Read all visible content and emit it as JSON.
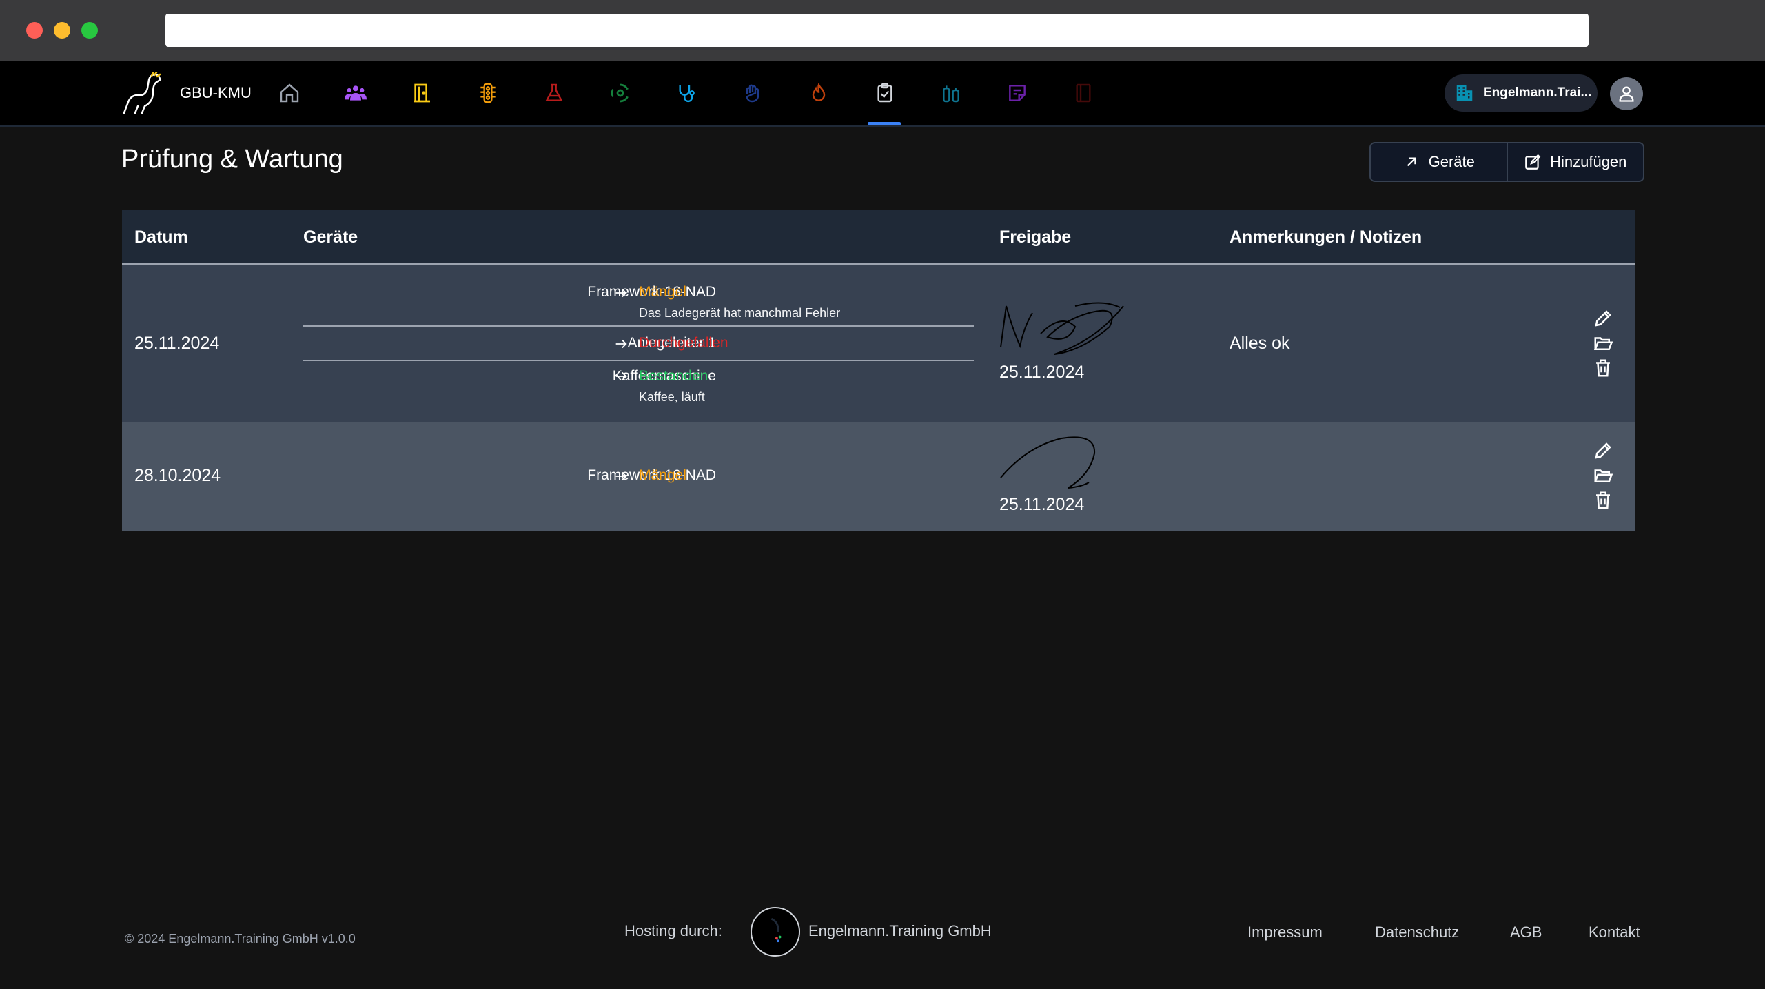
{
  "app": {
    "brand": "GBU-KMU",
    "organization": "Engelmann.Trai...",
    "nav_icons": [
      "home-icon",
      "users-icon",
      "door-icon",
      "traffic-light-icon",
      "flask-icon",
      "biohazard-icon",
      "stethoscope-icon",
      "hand-icon",
      "fire-icon",
      "clipboard-check-icon",
      "fire-extinguisher-icon",
      "notes-icon",
      "book-icon"
    ],
    "nav_active": "clipboard-check-icon",
    "colors": {
      "accent": "#3b82f6",
      "warning": "#f59e0b",
      "danger": "#dc2626",
      "success": "#22c55e"
    }
  },
  "page": {
    "title": "Prüfung & Wartung",
    "buttons": {
      "devices": "Geräte",
      "add": "Hinzufügen"
    }
  },
  "table": {
    "headers": {
      "date": "Datum",
      "devices": "Geräte",
      "release": "Freigabe",
      "notes": "Anmerkungen / Notizen"
    },
    "rows": [
      {
        "date": "25.11.2024",
        "devices": [
          {
            "name": "Framework-16-NAD",
            "status": "Mängel",
            "status_type": "warning",
            "note": "Das Ladegerät hat manchmal Fehler"
          },
          {
            "name": "Anlegeleiter 1",
            "status": "Durchgefallen",
            "status_type": "danger",
            "note": ""
          },
          {
            "name": "Kaffeemaschine",
            "status": "Bestanden",
            "status_type": "success",
            "note": "Kaffee, läuft"
          }
        ],
        "release_date": "25.11.2024",
        "remark": "Alles ok"
      },
      {
        "date": "28.10.2024",
        "devices": [
          {
            "name": "Framework-16-NAD",
            "status": "Mängel",
            "status_type": "warning",
            "note": ""
          }
        ],
        "release_date": "25.11.2024",
        "remark": ""
      }
    ]
  },
  "footer": {
    "copyright": "© 2024 Engelmann.Training GmbH v1.0.0",
    "hosting_label": "Hosting durch:",
    "host_name": "Engelmann.Training GmbH",
    "links": [
      "Impressum",
      "Datenschutz",
      "AGB",
      "Kontakt"
    ]
  }
}
